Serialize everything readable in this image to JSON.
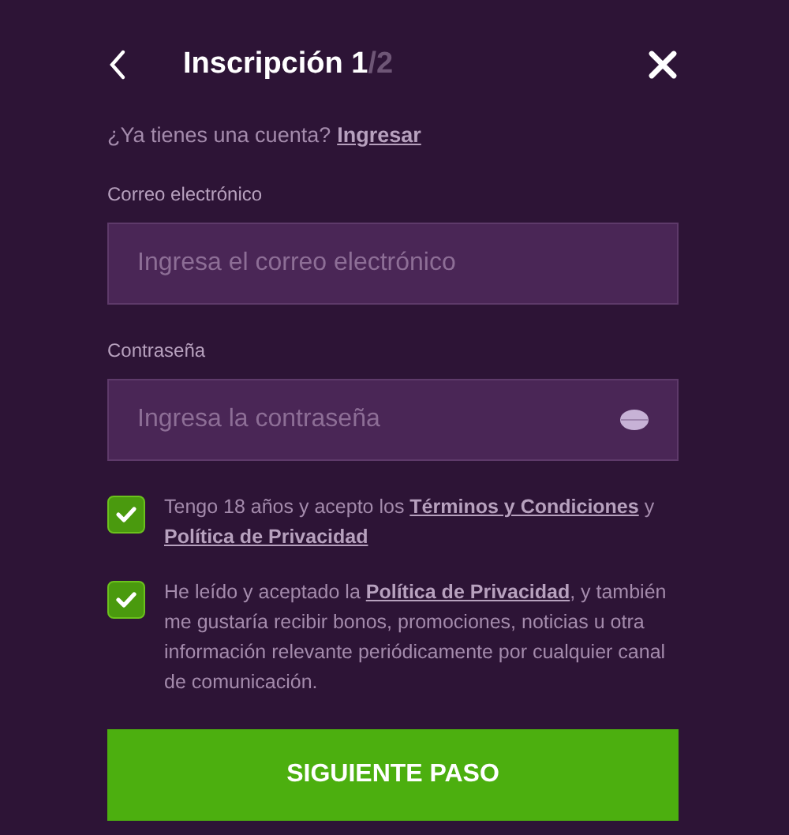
{
  "header": {
    "title": "Inscripción 1",
    "step_total": "/2"
  },
  "login_prompt": {
    "text": "¿Ya tienes una cuenta?",
    "link": "Ingresar"
  },
  "fields": [
    {
      "kind": "email",
      "label": "Correo electrónico",
      "placeholder": "Ingresa el correo electrónico"
    },
    {
      "kind": "password",
      "label": "Contraseña",
      "placeholder": "Ingresa la contraseña"
    }
  ],
  "consents": [
    {
      "checked": true,
      "parts": [
        {
          "kind": "text",
          "text": "Tengo 18 años y acepto los "
        },
        {
          "kind": "link",
          "text": "Términos y Condiciones"
        },
        {
          "kind": "text",
          "text": " y "
        },
        {
          "kind": "link",
          "text": "Política de Privacidad"
        }
      ]
    },
    {
      "checked": true,
      "parts": [
        {
          "kind": "text",
          "text": "He leído y aceptado la "
        },
        {
          "kind": "link",
          "text": "Política de Privacidad"
        },
        {
          "kind": "text",
          "text": ", y también me gustaría recibir bonos, promociones, noticias u otra información relevante periódicamente por cualquier canal de comunicación."
        }
      ]
    }
  ],
  "submit": "SIGUIENTE PASO"
}
